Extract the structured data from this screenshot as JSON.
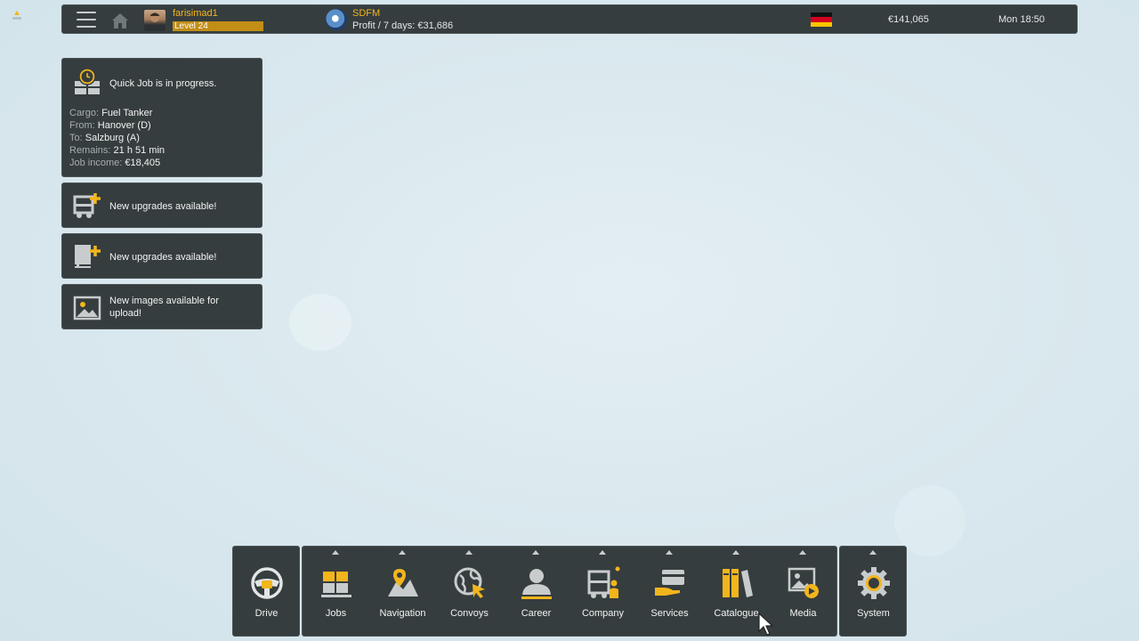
{
  "topbar": {
    "menu_icon": "hamburger-icon",
    "home_icon": "home-icon",
    "username": "farisimad1",
    "level": "Level 24",
    "company_name": "SDFM",
    "profit": "Profit / 7 days: €31,686",
    "flag": "germany",
    "money": "€141,065",
    "clock": "Mon 18:50"
  },
  "notifications": {
    "job": {
      "title": "Quick Job is in progress.",
      "cargo_label": "Cargo:",
      "cargo": "Fuel Tanker",
      "from_label": "From:",
      "from": "Hanover (D)",
      "to_label": "To:",
      "to": "Salzburg (A)",
      "remains_label": "Remains:",
      "remains": "21 h 51 min",
      "income_label": "Job income:",
      "income": "€18,405"
    },
    "upgrades_truck": "New upgrades available!",
    "upgrades_trailer": "New upgrades available!",
    "images": "New images available for upload!"
  },
  "menu": {
    "drive": "Drive",
    "jobs": "Jobs",
    "navigation": "Navigation",
    "convoys": "Convoys",
    "career": "Career",
    "company": "Company",
    "services": "Services",
    "catalogue": "Catalogue",
    "media": "Media",
    "system": "System"
  },
  "colors": {
    "accent": "#f2b51c",
    "panel": "#363d3f",
    "background": "#d9e8ee"
  }
}
